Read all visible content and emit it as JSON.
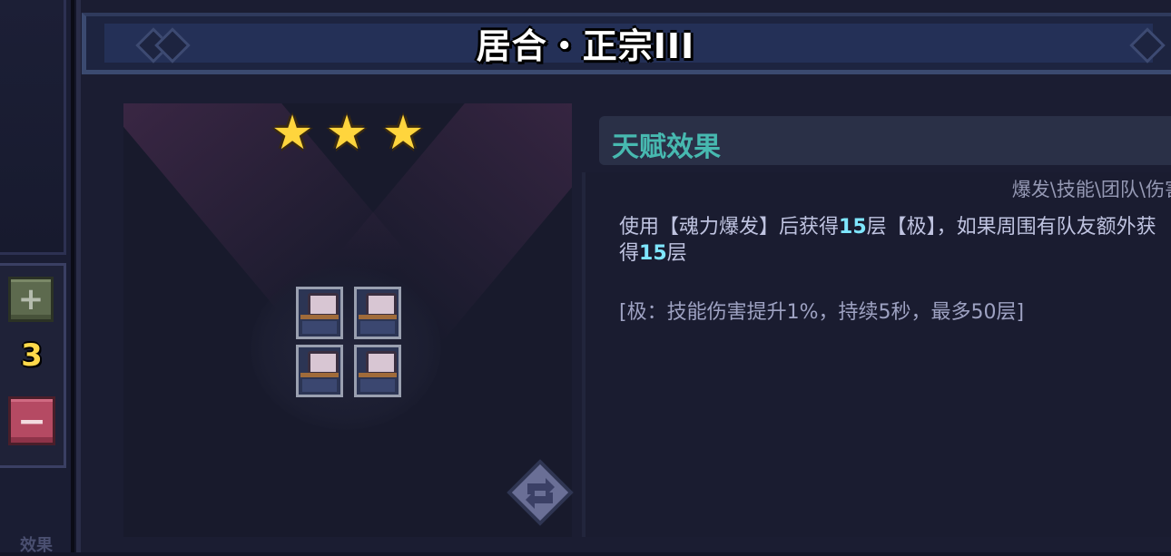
{
  "title": "居合・正宗III",
  "stars": [
    "★",
    "★",
    "★"
  ],
  "left_panel": {
    "plus_label": "+",
    "count": "3",
    "minus_label": "−",
    "caption": "效果"
  },
  "talent": {
    "header": "天赋效果",
    "tags": "爆发\\技能\\团队\\伤害",
    "desc_parts": {
      "p1": "使用【魂力爆发】后获得",
      "n1": "15",
      "p2": "层【极】，如果周围有队友额外获得",
      "n2": "15",
      "p3": "层"
    },
    "note": "[极：技能伤害提升1%，持续5秒，最多50层]"
  },
  "icons": {
    "plus": "plus-icon",
    "minus": "minus-icon",
    "swap": "swap-arrows-icon",
    "star": "star-icon",
    "unit": "character-sprite"
  },
  "colors": {
    "header_text": "#47b9b0",
    "highlight_number": "#7fe6ff",
    "count": "#ffd94a",
    "minus_button": "#b54a63",
    "plus_button": "#5d6a4e"
  }
}
